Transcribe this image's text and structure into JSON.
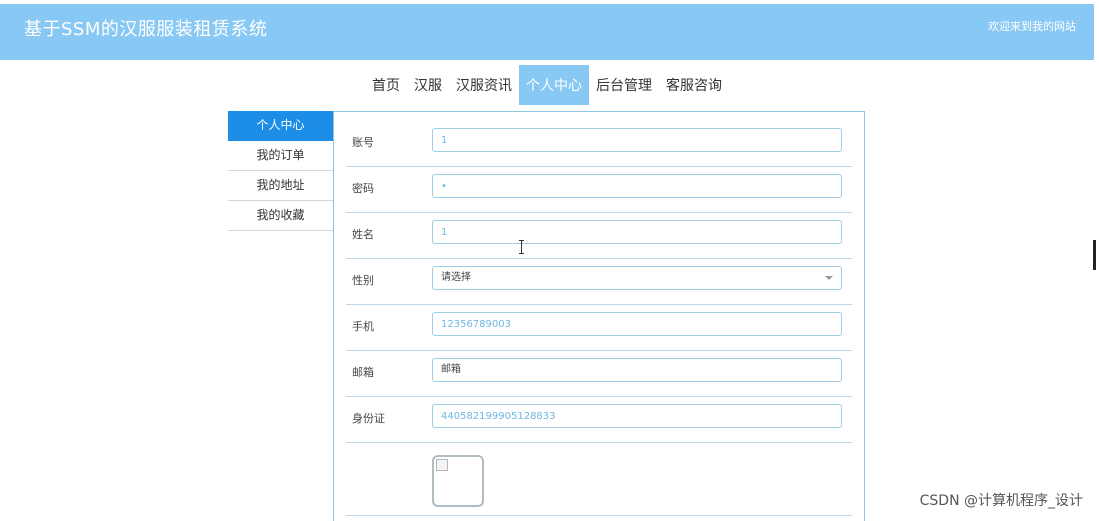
{
  "header": {
    "title": "基于SSM的汉服服装租赁系统",
    "welcome": "欢迎来到我的网站"
  },
  "nav": {
    "items": [
      {
        "label": "首页",
        "active": false
      },
      {
        "label": "汉服",
        "active": false
      },
      {
        "label": "汉服资讯",
        "active": false
      },
      {
        "label": "个人中心",
        "active": true
      },
      {
        "label": "后台管理",
        "active": false
      },
      {
        "label": "客服咨询",
        "active": false
      }
    ]
  },
  "sidebar": {
    "items": [
      {
        "label": "个人中心",
        "active": true
      },
      {
        "label": "我的订单",
        "active": false
      },
      {
        "label": "我的地址",
        "active": false
      },
      {
        "label": "我的收藏",
        "active": false
      }
    ]
  },
  "form": {
    "account": {
      "label": "账号",
      "value": "1"
    },
    "password": {
      "label": "密码",
      "value": "•"
    },
    "name": {
      "label": "姓名",
      "value": "1"
    },
    "gender": {
      "label": "性别",
      "placeholder": "请选择"
    },
    "phone": {
      "label": "手机",
      "value": "12356789003"
    },
    "email": {
      "label": "邮箱",
      "placeholder": "邮箱"
    },
    "id_card": {
      "label": "身份证",
      "value": "440582199905128833"
    }
  },
  "watermark": "CSDN @计算机程序_设计",
  "colors": {
    "header_bg": "#88c8f4",
    "sidebar_active": "#1c8ee8",
    "input_border": "#9fcde6",
    "input_text": "#6fb7e2"
  }
}
